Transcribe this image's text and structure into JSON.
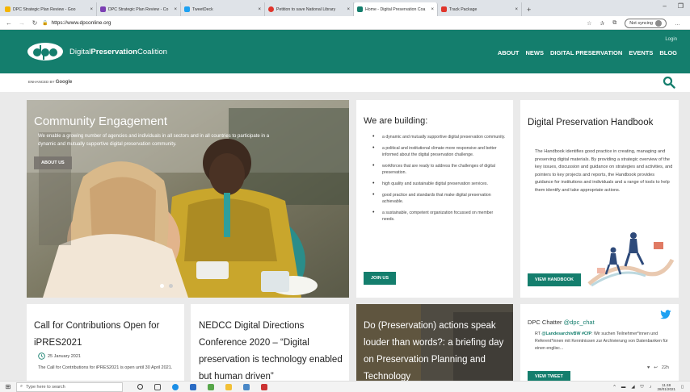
{
  "browser": {
    "tabs": [
      {
        "title": "DPC Strategic Plan Review - Goo",
        "color": "#f4b400",
        "active": false
      },
      {
        "title": "DPC Strategic Plan Review - Co",
        "color": "#7b3fb3",
        "active": false
      },
      {
        "title": "TweetDeck",
        "color": "#1da1f2",
        "active": false
      },
      {
        "title": "Petition to save National Library",
        "color": "#e0352b",
        "active": false
      },
      {
        "title": "Home - Digital Preservation Coa",
        "color": "#147e6d",
        "active": true
      },
      {
        "title": "Track Package",
        "color": "#e0352b",
        "active": false
      }
    ],
    "new_tab": "+",
    "url": "https://www.dpconline.org",
    "sync_label": "Not syncing"
  },
  "site": {
    "brand_light": "Digital",
    "brand_bold": "Preservation",
    "brand_end": "Coalition",
    "login": "Login",
    "nav": [
      "ABOUT",
      "NEWS",
      "DIGITAL PRESERVATION",
      "EVENTS",
      "BLOG"
    ],
    "search_enhanced": "ENHANCED BY",
    "search_google": "Google"
  },
  "hero": {
    "title": "Community Engagement",
    "text": "We enable a growing number of agencies and individuals in all sectors and in all countries to participate in a dynamic and mutually supportive digital preservation community.",
    "button": "ABOUT US",
    "slide_count": 2,
    "active_slide": 1
  },
  "building": {
    "title": "We are building:",
    "items": [
      "a dynamic and mutually supportive digital preservation community.",
      "a political and institutional climate more responsive and better informed about the digital preservation challenge.",
      "workforces that are ready to address the challenges of digital preservation.",
      "high quality and sustainable digital preservation services.",
      "good practice and standards that make digital preservation achievable.",
      "a sustainable, competent organization focussed on member needs."
    ],
    "button": "JOIN US"
  },
  "handbook": {
    "title": "Digital Preservation Handbook",
    "text": "The Handbook identifies good practice in creating, managing and preserving digital materials. By providing a strategic overview of the key issues, discussion and guidance on strategies and activities, and pointers to key projects and reports, the Handbook provides guidance for institutions and individuals and a range of tools to help them identify and take appropriate actions.",
    "button": "VIEW HANDBOOK"
  },
  "news": [
    {
      "title": "Call for Contributions Open for iPRES2021",
      "date": "25 January 2021",
      "text": "The Call for Contributions for iPRES2021 is open until 30 April 2021."
    },
    {
      "title": "NEDCC Digital Directions Conference 2020 – “Digital preservation is technology enabled but human driven”"
    },
    {
      "title": "Do (Preservation) actions speak louder than words?: a briefing day on Preservation Planning and Technology"
    }
  ],
  "twitter": {
    "label": "DPC Chatter",
    "handle": "@dpc_chat",
    "rt": "RT",
    "mention": "@LandesarchivBW",
    "hashtag": "#CfP",
    "text": ": Wir suchen Teilnehmer*innen und Referent*innen mit Kenntnissen zur Archivierung von Datenbanken für einen englisc...",
    "likes": "♥",
    "replies": "↩",
    "time": "22h",
    "button": "VIEW TWEET"
  },
  "taskbar": {
    "search_placeholder": "Type here to search",
    "time": "11:48",
    "date": "28/01/2021"
  },
  "colors": {
    "brand": "#147e6d",
    "header_bg": "#147e6d"
  }
}
